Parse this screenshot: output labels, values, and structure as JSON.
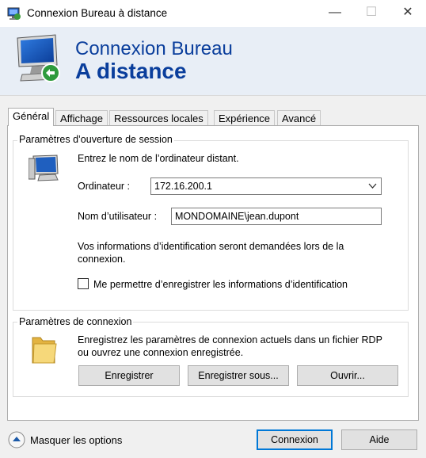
{
  "window": {
    "title": "Connexion Bureau à distance",
    "minimize_glyph": "—",
    "maximize_glyph": "☐",
    "close_glyph": "✕"
  },
  "banner": {
    "line1": "Connexion Bureau",
    "line2": "A distance",
    "icon": "rdp-computer-icon"
  },
  "tabs": [
    {
      "label": "Général",
      "active": true
    },
    {
      "label": "Affichage",
      "active": false
    },
    {
      "label": "Ressources locales",
      "active": false
    },
    {
      "label": "Expérience",
      "active": false
    },
    {
      "label": "Avancé",
      "active": false
    }
  ],
  "session": {
    "legend": "Paramètres d’ouverture de session",
    "instruction": "Entrez le nom de l’ordinateur distant.",
    "computer_label": "Ordinateur :",
    "computer_value": "172.16.200.1",
    "username_label": "Nom d’utilisateur :",
    "username_value": "MONDOMAINE\\jean.dupont",
    "credentials_note": "Vos informations d’identification seront demandées lors de la connexion.",
    "save_credentials_label": "Me permettre d’enregistrer les informations d’identification",
    "save_credentials_checked": false
  },
  "connection": {
    "legend": "Paramètres de connexion",
    "description": "Enregistrez les paramètres de connexion actuels dans un fichier RDP ou ouvrez une connexion enregistrée.",
    "save_label": "Enregistrer",
    "save_as_label": "Enregistrer sous...",
    "open_label": "Ouvrir..."
  },
  "footer": {
    "hide_options_label": "Masquer les options",
    "connect_label": "Connexion",
    "help_label": "Aide"
  },
  "colors": {
    "banner_text": "#0a3e9c",
    "banner_bg": "#e8eef6",
    "accent": "#0078d7"
  }
}
